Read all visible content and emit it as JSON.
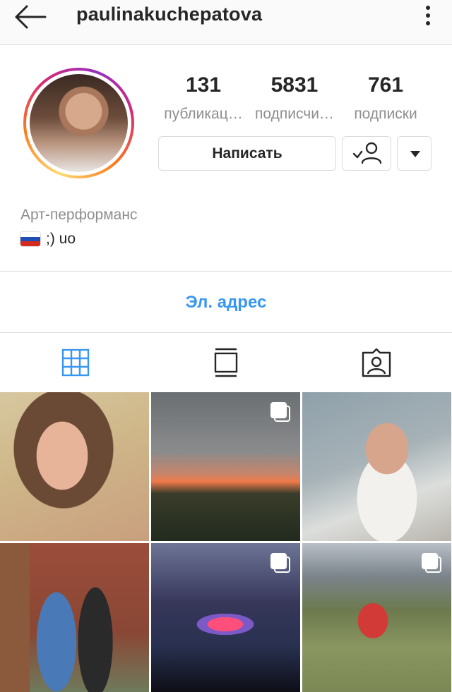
{
  "header": {
    "username": "paulinakuchepatova",
    "back_icon": "arrow-left-icon",
    "more_icon": "more-vertical-icon"
  },
  "profile": {
    "stats": [
      {
        "value": "131",
        "label": "публикац…"
      },
      {
        "value": "5831",
        "label": "подписчи…"
      },
      {
        "value": "761",
        "label": "подписки"
      }
    ],
    "message_button": "Написать",
    "follow_icon": "person-check-icon",
    "dropdown_icon": "caret-down-icon",
    "category": "Арт-перформанс",
    "bio": ";) uo",
    "bio_flag": "russian-flag"
  },
  "contact": {
    "email_label": "Эл. адрес"
  },
  "tabs": [
    {
      "icon": "grid-icon",
      "active": true
    },
    {
      "icon": "feed-list-icon",
      "active": false
    },
    {
      "icon": "tagged-person-icon",
      "active": false
    }
  ],
  "colors": {
    "accent": "#3897f0",
    "text": "#262626",
    "secondary": "#8e8e8e",
    "border": "#dbdbdb"
  },
  "grid": {
    "posts": [
      {
        "multi": false
      },
      {
        "multi": true
      },
      {
        "multi": false
      },
      {
        "multi": false
      },
      {
        "multi": true
      },
      {
        "multi": true
      }
    ]
  }
}
